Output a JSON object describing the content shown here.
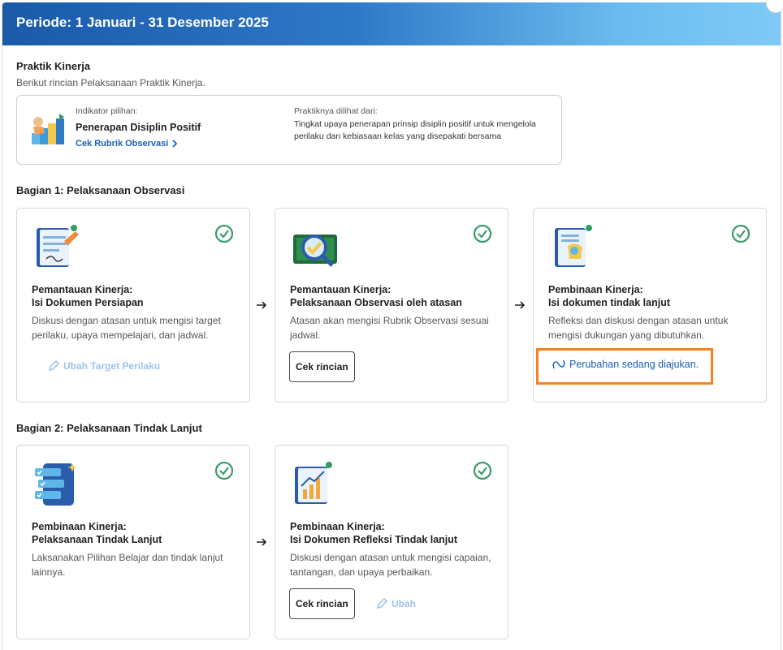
{
  "header": {
    "title": "Periode: 1 Januari - 31 Desember 2025"
  },
  "praktik": {
    "title": "Praktik Kinerja",
    "subtitle": "Berikut rincian Pelaksanaan Praktik Kinerja.",
    "indikator_label": "Indikator pilihan:",
    "indikator_value": "Penerapan Disiplin Positif",
    "rubrik_link": "Cek Rubrik Observasi",
    "dilihat_label": "Praktiknya dilihat dari:",
    "dilihat_desc": "Tingkat upaya penerapan prinsip disiplin positif untuk mengelola perilaku dan kebiasaan kelas yang disepakati bersama"
  },
  "bagian1": {
    "title": "Bagian 1: Pelaksanaan Observasi",
    "cards": [
      {
        "title_line1": "Pemantauan Kinerja:",
        "title_line2": "Isi Dokumen Persiapan",
        "desc": "Diskusi dengan atasan untuk mengisi target perilaku, upaya mempelajari, dan jadwal.",
        "action": "Ubah Target Perilaku"
      },
      {
        "title_line1": "Pemantauan Kinerja:",
        "title_line2": "Pelaksanaan Observasi oleh atasan",
        "desc": "Atasan akan mengisi Rubrik Observasi sesuai jadwal.",
        "action": "Cek rincian"
      },
      {
        "title_line1": "Pembinaan Kinerja:",
        "title_line2": "Isi dokumen tindak lanjut",
        "desc": "Refleksi dan diskusi dengan atasan untuk mengisi dukungan yang dibutuhkan.",
        "action": "Perubahan sedang diajukan."
      }
    ]
  },
  "bagian2": {
    "title": "Bagian 2: Pelaksanaan Tindak Lanjut",
    "cards": [
      {
        "title_line1": "Pembinaan Kinerja:",
        "title_line2": "Pelaksanaan Tindak Lanjut",
        "desc": "Laksanakan Pilihan Belajar dan tindak lanjut lainnya."
      },
      {
        "title_line1": "Pembinaan Kinerja:",
        "title_line2": "Isi Dokumen Refleksi Tindak lanjut",
        "desc": "Diskusi dengan atasan untuk mengisi capaian, tantangan, dan upaya perbaikan.",
        "action": "Cek rincian",
        "secondary_action": "Ubah"
      }
    ]
  },
  "colors": {
    "accent": "#1a5fb4",
    "check": "#3a9a6a",
    "highlight": "#f5821f",
    "muted_link": "#9fc3ec"
  }
}
